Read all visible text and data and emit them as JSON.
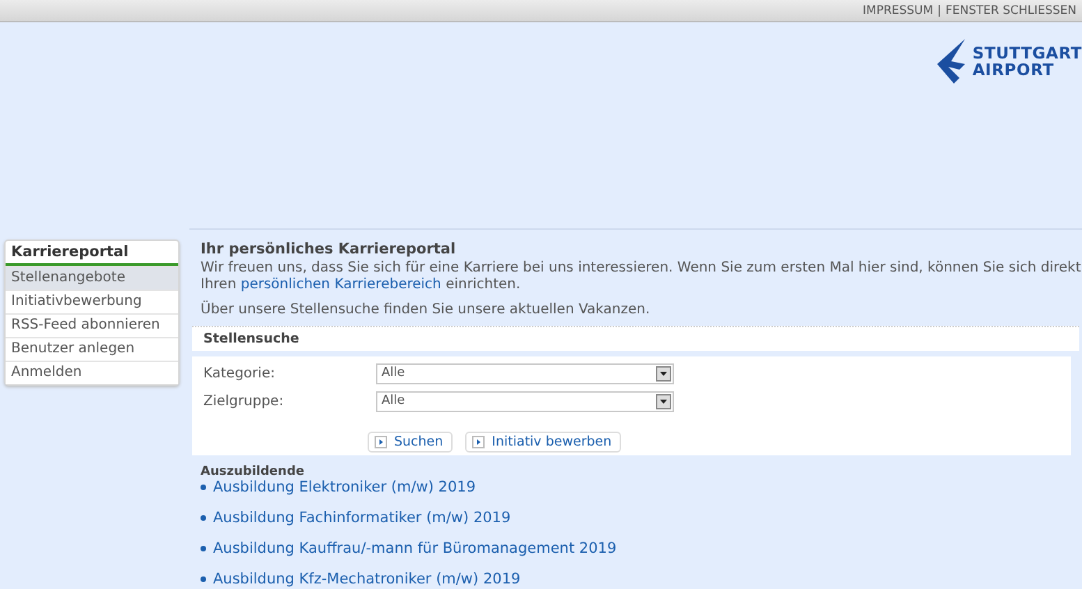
{
  "top_bar": {
    "links": [
      "IMPRESSUM",
      "FENSTER SCHLIESSEN"
    ],
    "separator": "|"
  },
  "logo": {
    "line_1": "STUTTGART",
    "line_2": "AIRPORT"
  },
  "sidebar": {
    "title": "Karriereportal",
    "items": [
      {
        "label": "Stellenangebote",
        "selected": true
      },
      {
        "label": "Initiativbewerbung",
        "selected": false
      },
      {
        "label": "RSS-Feed abonnieren",
        "selected": false
      },
      {
        "label": "Benutzer anlegen",
        "selected": false
      },
      {
        "label": "Anmelden",
        "selected": false
      }
    ]
  },
  "intro": {
    "title": "Ihr persönliches Karriereportal",
    "text_before": "Wir freuen uns, dass Sie sich für eine Karriere bei uns interessieren. Wenn Sie zum ersten Mal hier sind, können Sie sich direkt Ihren ",
    "link": "persönlichen Karrierebereich",
    "text_after": " einrichten.",
    "note": "Über unsere Stellensuche finden Sie unsere aktuellen Vakanzen."
  },
  "search": {
    "title": "Stellensuche",
    "fields": [
      {
        "label": "Kategorie:",
        "value": "Alle"
      },
      {
        "label": "Zielgruppe:",
        "value": "Alle"
      }
    ],
    "buttons": [
      "Suchen",
      "Initiativ bewerben"
    ]
  },
  "jobs": {
    "group": "Auszubildende",
    "items": [
      "Ausbildung Elektroniker (m/w) 2019",
      "Ausbildung Fachinformatiker (m/w) 2019",
      "Ausbildung Kauffrau/-mann für Büromanagement 2019",
      "Ausbildung Kfz-Mechatroniker (m/w) 2019"
    ]
  }
}
